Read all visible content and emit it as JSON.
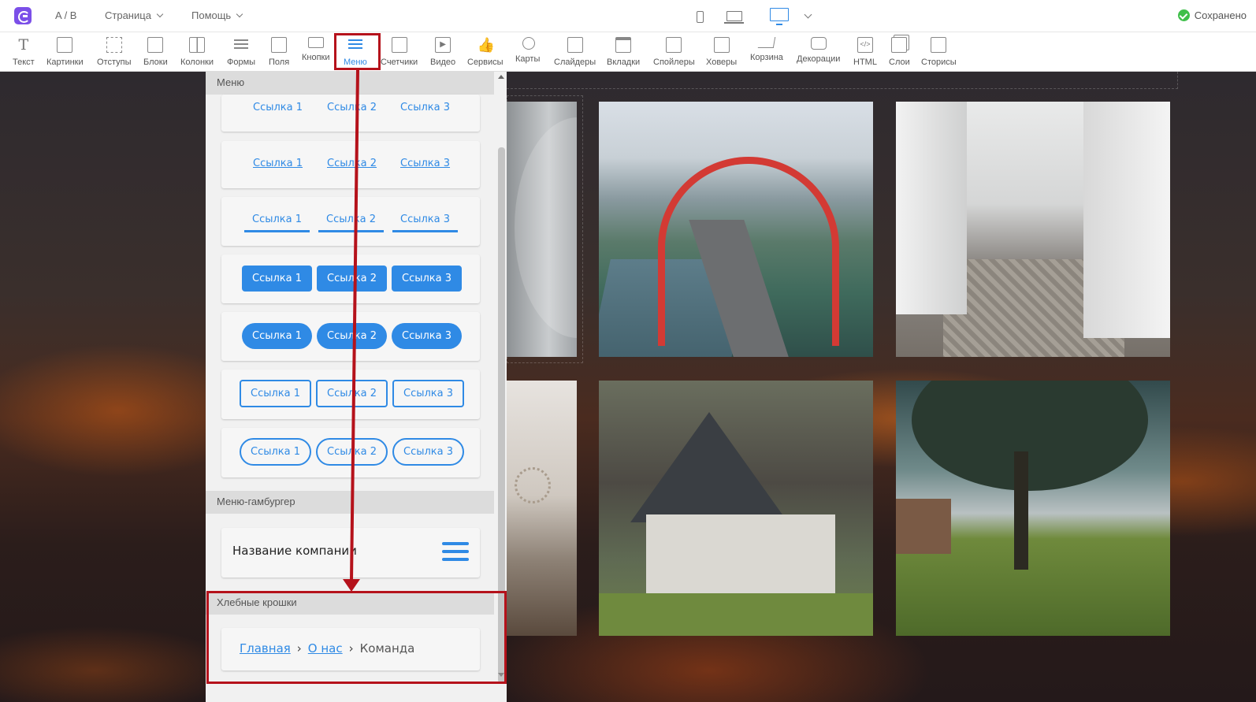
{
  "topbar": {
    "ab_label": "A / B",
    "page_menu": "Страница",
    "help_menu": "Помощь",
    "saved_status": "Сохранено"
  },
  "toolbar": {
    "items": [
      {
        "label": "Текст",
        "icon": "text-icon"
      },
      {
        "label": "Картинки",
        "icon": "image-icon"
      },
      {
        "label": "Отступы",
        "icon": "padding-icon"
      },
      {
        "label": "Блоки",
        "icon": "block-icon"
      },
      {
        "label": "Колонки",
        "icon": "columns-icon"
      },
      {
        "label": "Формы",
        "icon": "form-icon"
      },
      {
        "label": "Поля",
        "icon": "field-icon"
      },
      {
        "label": "Кнопки",
        "icon": "button-icon"
      },
      {
        "label": "Меню",
        "icon": "menu-icon"
      },
      {
        "label": "Счетчики",
        "icon": "counter-icon"
      },
      {
        "label": "Видео",
        "icon": "video-icon"
      },
      {
        "label": "Сервисы",
        "icon": "thumbs-up-icon"
      },
      {
        "label": "Карты",
        "icon": "map-pin-icon"
      },
      {
        "label": "Слайдеры",
        "icon": "slider-icon"
      },
      {
        "label": "Вкладки",
        "icon": "tabs-icon"
      },
      {
        "label": "Спойлеры",
        "icon": "spoiler-icon"
      },
      {
        "label": "Ховеры",
        "icon": "hover-icon"
      },
      {
        "label": "Корзина",
        "icon": "cart-icon"
      },
      {
        "label": "Декорации",
        "icon": "speech-bubble-icon"
      },
      {
        "label": "HTML",
        "icon": "code-icon"
      },
      {
        "label": "Слои",
        "icon": "layers-icon"
      },
      {
        "label": "Сторисы",
        "icon": "stories-icon"
      }
    ]
  },
  "panel": {
    "menu_section": "Меню",
    "link1": "Ссылка 1",
    "link2": "Ссылка 2",
    "link3": "Ссылка 3",
    "hamburger_section": "Меню-гамбургер",
    "company_name": "Название компании",
    "breadcrumbs_section": "Хлебные крошки",
    "breadcrumbs": {
      "home": "Главная",
      "sep": "›",
      "about": "О нас",
      "current": "Команда"
    }
  },
  "colors": {
    "accent": "#2f8ae5",
    "highlight_frame": "#b5121b",
    "saved_check": "#3fbf4a",
    "logo": "#7b4fe8"
  }
}
